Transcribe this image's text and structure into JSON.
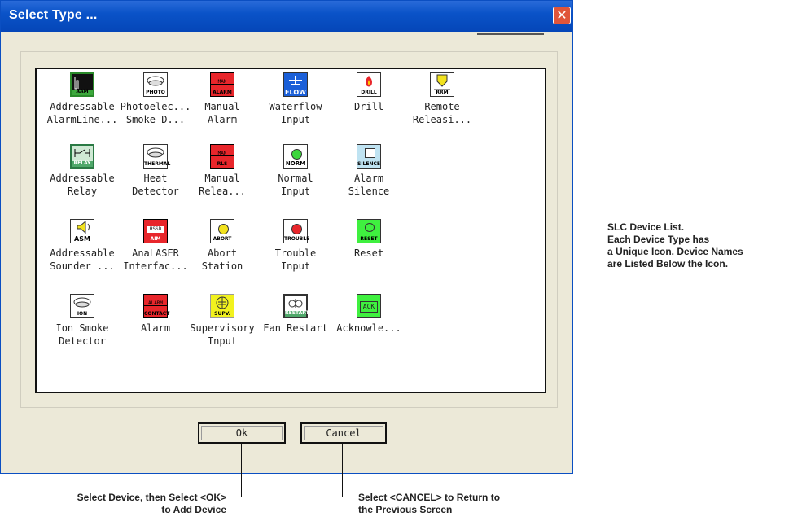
{
  "window": {
    "title": "Select Type ...",
    "close_glyph": "✕"
  },
  "devices": [
    {
      "line1": "Addressable",
      "line2": "AlarmLine...",
      "icon": "aam-icon",
      "code": "AAM"
    },
    {
      "line1": "Photoelec...",
      "line2": "Smoke D...",
      "icon": "photo-detector-icon",
      "code": "PHOTO"
    },
    {
      "line1": "Manual",
      "line2": "Alarm",
      "icon": "manual-alarm-icon",
      "code": "MAN / ALARM"
    },
    {
      "line1": "Waterflow",
      "line2": "Input",
      "icon": "waterflow-icon",
      "code": "FLOW"
    },
    {
      "line1": "Drill",
      "line2": "",
      "icon": "drill-icon",
      "code": "DRILL"
    },
    {
      "line1": "Remote",
      "line2": "Releasi...",
      "icon": "rrm-icon",
      "code": "RRM"
    },
    {
      "line1": "Addressable",
      "line2": "Relay",
      "icon": "relay-icon",
      "code": "RELAY"
    },
    {
      "line1": "Heat",
      "line2": "Detector",
      "icon": "thermal-detector-icon",
      "code": "THERMAL"
    },
    {
      "line1": "Manual",
      "line2": "Relea...",
      "icon": "manual-release-icon",
      "code": "MAN / RLS"
    },
    {
      "line1": "Normal",
      "line2": "Input",
      "icon": "normal-input-icon",
      "code": "NORM"
    },
    {
      "line1": "Alarm",
      "line2": "Silence",
      "icon": "silence-icon",
      "code": "SILENCE"
    },
    {
      "line1": "Addressable",
      "line2": "Sounder ...",
      "icon": "sounder-icon",
      "code": "ASM"
    },
    {
      "line1": "AnaLASER",
      "line2": "Interfac...",
      "icon": "hssd-icon",
      "code": "HSSD / AIM"
    },
    {
      "line1": "Abort",
      "line2": "Station",
      "icon": "abort-icon",
      "code": "ABORT"
    },
    {
      "line1": "Trouble",
      "line2": "Input",
      "icon": "trouble-icon",
      "code": "TROUBLE"
    },
    {
      "line1": "Reset",
      "line2": "",
      "icon": "reset-icon",
      "code": "RESET"
    },
    {
      "line1": "Ion Smoke",
      "line2": "Detector",
      "icon": "ion-detector-icon",
      "code": "ION"
    },
    {
      "line1": "Alarm",
      "line2": "",
      "icon": "alarm-contact-icon",
      "code": "ALARM / CONTACT"
    },
    {
      "line1": "Supervisory",
      "line2": "Input",
      "icon": "supervisory-icon",
      "code": "SUPV."
    },
    {
      "line1": "Fan Restart",
      "line2": "",
      "icon": "fan-restart-icon",
      "code": "RESTART"
    },
    {
      "line1": "Acknowle...",
      "line2": "",
      "icon": "ack-icon",
      "code": "ACK"
    }
  ],
  "buttons": {
    "ok": "Ok",
    "cancel": "Cancel"
  },
  "annotations": {
    "list_line1": "SLC Device List.",
    "list_line2": "Each Device Type has",
    "list_line3": "a Unique Icon. Device Names",
    "list_line4": "are Listed Below the Icon.",
    "ok_line1": "Select Device, then Select <OK>",
    "ok_line2": "to Add Device",
    "cancel_line1": "Select <CANCEL> to Return to",
    "cancel_line2": "the Previous Screen"
  },
  "colors": {
    "title_bar": "#0a53c8",
    "close_button": "#e0553a",
    "alarm_red": "#e8262b",
    "relay_green": "#4fa86a",
    "reset_green": "#3ff03f",
    "supv_yellow": "#f2f21e"
  }
}
